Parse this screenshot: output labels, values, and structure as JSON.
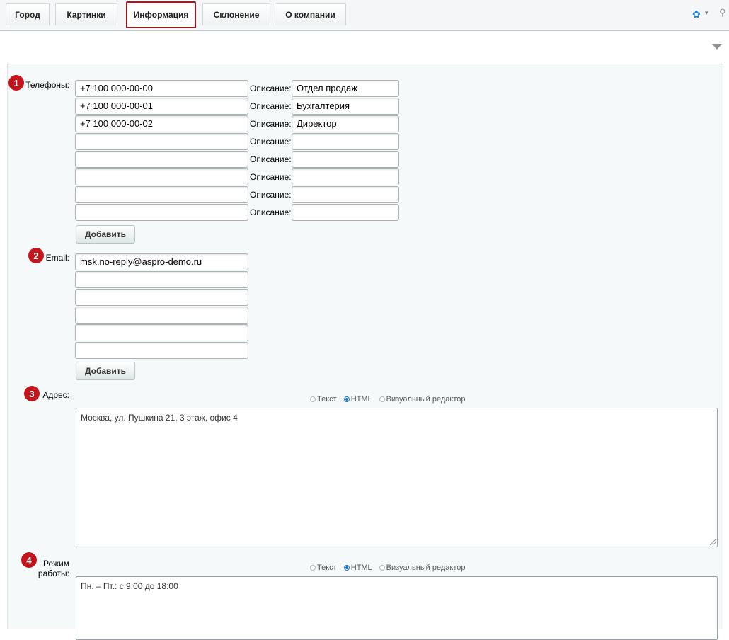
{
  "tabs": [
    {
      "label": "Город"
    },
    {
      "label": "Картинки"
    },
    {
      "label": "Информация"
    },
    {
      "label": "Склонение"
    },
    {
      "label": "О компании"
    }
  ],
  "phones": {
    "badge": "1",
    "label": "Телефоны:",
    "desc_label": "Описание:",
    "rows": [
      {
        "number": "+7 100 000-00-00",
        "desc": "Отдел продаж"
      },
      {
        "number": "+7 100 000-00-01",
        "desc": "Бухгалтерия"
      },
      {
        "number": "+7 100 000-00-02",
        "desc": "Директор"
      },
      {
        "number": "",
        "desc": ""
      },
      {
        "number": "",
        "desc": ""
      },
      {
        "number": "",
        "desc": ""
      },
      {
        "number": "",
        "desc": ""
      },
      {
        "number": "",
        "desc": ""
      }
    ],
    "add_label": "Добавить"
  },
  "email": {
    "badge": "2",
    "label": "Email:",
    "rows": [
      "msk.no-reply@aspro-demo.ru",
      "",
      "",
      "",
      "",
      ""
    ],
    "add_label": "Добавить"
  },
  "address": {
    "badge": "3",
    "label": "Адрес:",
    "modes": [
      "Текст",
      "HTML",
      "Визуальный редактор"
    ],
    "selected_mode": "HTML",
    "value": "Москва, ул. Пушкина 21, 3 этаж, офис 4"
  },
  "schedule": {
    "badge": "4",
    "label_line1": "Режим",
    "label_line2": "работы:",
    "modes": [
      "Текст",
      "HTML",
      "Визуальный редактор"
    ],
    "selected_mode": "HTML",
    "value": "Пн. – Пт.: с 9:00 до 18:00"
  },
  "colors": {
    "accent_red": "#c4151c",
    "active_tab_border": "#9b1c1c",
    "radio_blue": "#1a72c9"
  }
}
